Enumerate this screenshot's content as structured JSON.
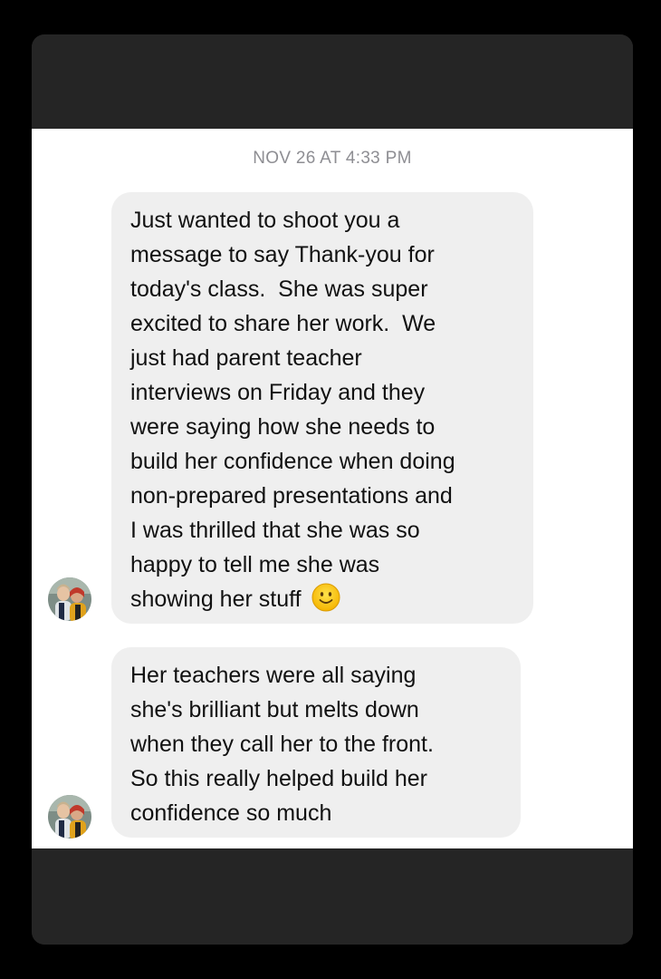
{
  "conversation": {
    "timestamp": "NOV 26 AT 4:33 PM",
    "messages": [
      {
        "sender": "other",
        "text": "Just wanted to shoot you a\nmessage to say Thank-you for\ntoday's class.  She was super\nexcited to share her work.  We\njust had parent teacher\ninterviews on Friday and they\nwere saying how she needs to\nbuild her confidence when doing\nnon-prepared presentations and\nI was thrilled that she was so\nhappy to tell me she was\nshowing her stuff",
        "emoji": "slightly-smiling-face-icon"
      },
      {
        "sender": "other",
        "text": "Her teachers were all saying\nshe's brilliant but melts down\nwhen they call her to the front.\nSo this really helped build her\nconfidence so much"
      }
    ]
  },
  "colors": {
    "background": "#000000",
    "bars": "#252525",
    "chat_bg": "#ffffff",
    "bubble_bg": "#efefef",
    "timestamp": "#8e8e93",
    "text": "#111111"
  }
}
